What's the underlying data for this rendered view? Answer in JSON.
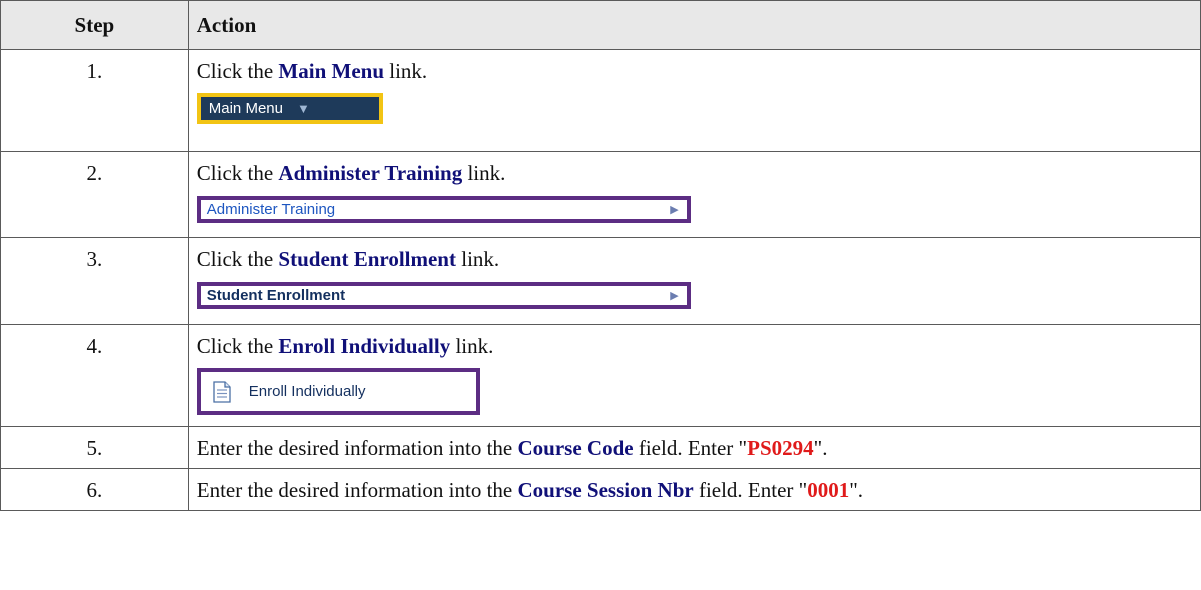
{
  "headers": {
    "step": "Step",
    "action": "Action"
  },
  "rows": [
    {
      "num": "1.",
      "pre": "Click the ",
      "bold": "Main Menu",
      "post": " link.",
      "widget_label": "Main Menu"
    },
    {
      "num": "2.",
      "pre": "Click the ",
      "bold": "Administer Training",
      "post": " link.",
      "widget_label": "Administer Training"
    },
    {
      "num": "3.",
      "pre": "Click the ",
      "bold": "Student Enrollment",
      "post": " link.",
      "widget_label": "Student Enrollment"
    },
    {
      "num": "4.",
      "pre": "Click the ",
      "bold": "Enroll Individually",
      "post": " link.",
      "widget_label": "Enroll Individually"
    },
    {
      "num": "5.",
      "pre": "Enter the desired information into the ",
      "bold": "Course Code",
      "mid": " field. Enter \"",
      "value": "PS0294",
      "end": "\"."
    },
    {
      "num": "6.",
      "pre": "Enter the desired information into the ",
      "bold": "Course Session Nbr",
      "mid": " field. Enter \"",
      "value": "0001",
      "end": "\"."
    }
  ],
  "colors": {
    "highlight_main_menu": "#f2c414",
    "highlight_menu": "#5c2d83",
    "bold_text": "#101078",
    "entered_value": "#e01a1a"
  },
  "icons": {
    "main_menu_dropdown": "triangle-down-icon",
    "menu_arrow": "chevron-right-icon",
    "enroll": "document-icon"
  }
}
